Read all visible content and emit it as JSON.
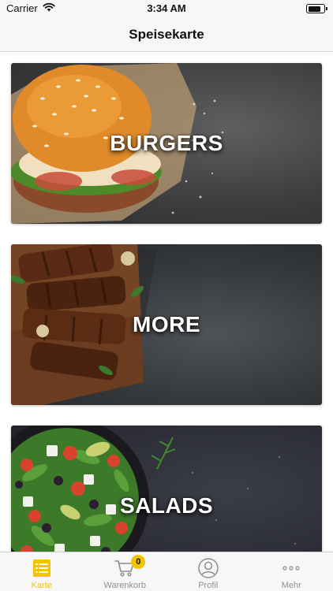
{
  "status_bar": {
    "carrier": "Carrier",
    "time": "3:34 AM"
  },
  "nav": {
    "title": "Speisekarte"
  },
  "categories": [
    {
      "label": "BURGERS"
    },
    {
      "label": "MORE"
    },
    {
      "label": "SALADS"
    }
  ],
  "tab_bar": {
    "accent_color": "#f5c400",
    "tabs": [
      {
        "label": "Karte",
        "icon": "menu-list-icon",
        "active": true
      },
      {
        "label": "Warenkorb",
        "icon": "cart-icon",
        "badge": "0"
      },
      {
        "label": "Profil",
        "icon": "profile-icon"
      },
      {
        "label": "Mehr",
        "icon": "more-dots-icon"
      }
    ]
  }
}
